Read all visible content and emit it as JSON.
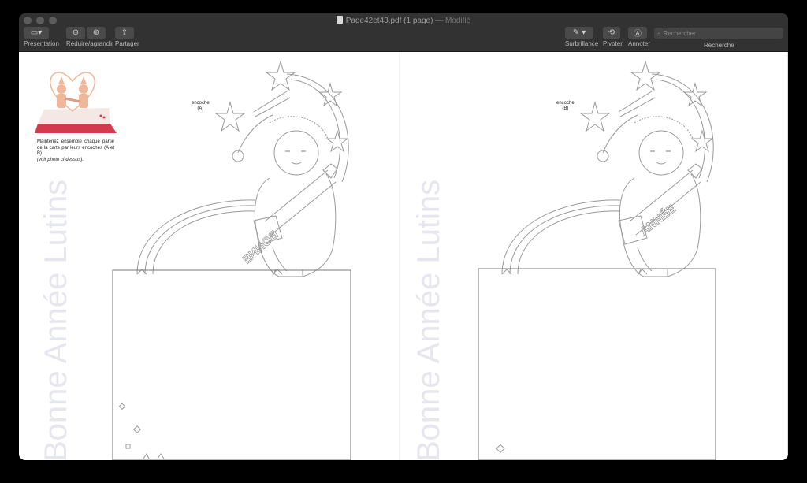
{
  "window": {
    "title": "Page42et43.pdf (1 page)",
    "modified": "— Modifié"
  },
  "toolbar": {
    "presentation_label": "Présentation",
    "zoom_label": "Réduire/agrandir",
    "share_label": "Partager",
    "highlight_label": "Surbrillance",
    "rotate_label": "Pivoter",
    "annotate_label": "Annoter",
    "search_placeholder": "Rechercher",
    "search_label": "Recherche"
  },
  "document": {
    "instructions": "Maintenez ensemble chaque partie de la carte par leurs encoches (A et B).",
    "instructions_note": "(voir photo ci-dessus).",
    "left_page": {
      "notch_label": "encoche",
      "notch_id": "(A)",
      "banner_word": "BONNE",
      "watermark": "Bonne Année Lutins"
    },
    "right_page": {
      "notch_label": "encoche",
      "notch_id": "(B)",
      "banner_word": "ANNÉE",
      "watermark": "Bonne Année Lutins"
    }
  },
  "colors": {
    "toolbar_bg": "#323232",
    "button_bg": "#4a4a4a",
    "line_art": "#9a9a9a",
    "watermark": "#e6e6ee",
    "photo_base": "#d43a4e",
    "photo_figure": "#f0b89a"
  }
}
